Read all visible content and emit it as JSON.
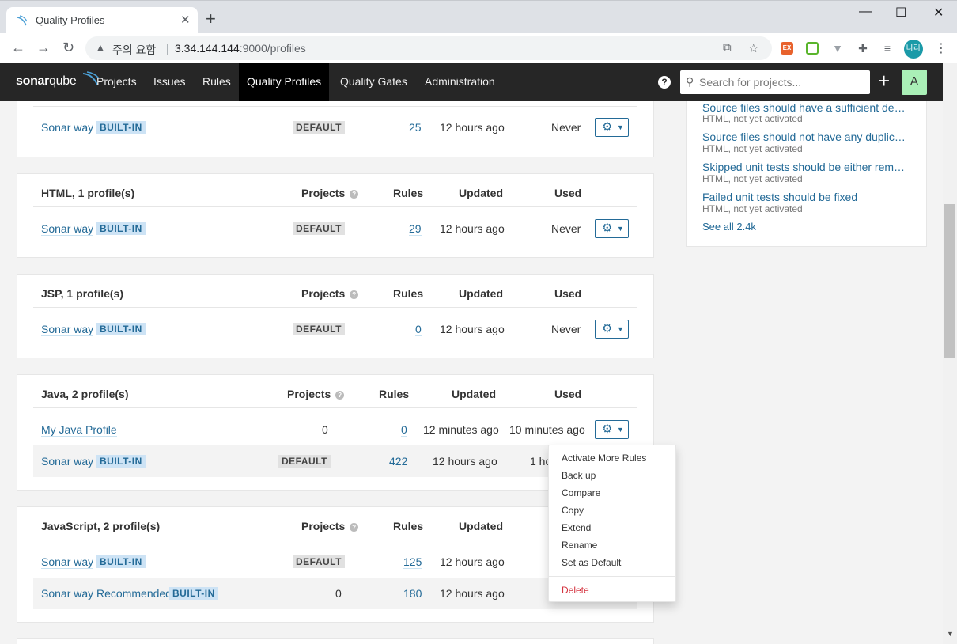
{
  "browser": {
    "tab_title": "Quality Profiles",
    "security_warning": "주의 요함",
    "url_host": "3.34.144.144",
    "url_path": ":9000/profiles",
    "profile_initials": "나라"
  },
  "nav": {
    "logo_bold": "sonar",
    "logo_light": "qube",
    "items": [
      "Projects",
      "Issues",
      "Rules",
      "Quality Profiles",
      "Quality Gates",
      "Administration"
    ],
    "active": "Quality Profiles",
    "search_placeholder": "Search for projects...",
    "avatar": "A"
  },
  "columns": {
    "projects": "Projects",
    "rules": "Rules",
    "updated": "Updated",
    "used": "Used"
  },
  "labels": {
    "built_in": "BUILT-IN",
    "default": "DEFAULT"
  },
  "languages": [
    {
      "header": "",
      "profiles": [
        {
          "name": "Sonar way",
          "built_in": true,
          "projects": "DEFAULT",
          "rules": "25",
          "updated": "12 hours ago",
          "used": "Never"
        }
      ]
    },
    {
      "header": "HTML, 1 profile(s)",
      "profiles": [
        {
          "name": "Sonar way",
          "built_in": true,
          "projects": "DEFAULT",
          "rules": "29",
          "updated": "12 hours ago",
          "used": "Never"
        }
      ]
    },
    {
      "header": "JSP, 1 profile(s)",
      "profiles": [
        {
          "name": "Sonar way",
          "built_in": true,
          "projects": "DEFAULT",
          "rules": "0",
          "updated": "12 hours ago",
          "used": "Never"
        }
      ]
    },
    {
      "header": "Java, 2 profile(s)",
      "profiles": [
        {
          "name": "My Java Profile",
          "built_in": false,
          "projects": "0",
          "rules": "0",
          "updated": "12 minutes ago",
          "used": "10 minutes ago"
        },
        {
          "name": "Sonar way",
          "built_in": true,
          "projects": "DEFAULT",
          "rules": "422",
          "updated": "12 hours ago",
          "used": "1 ho"
        }
      ]
    },
    {
      "header": "JavaScript, 2 profile(s)",
      "profiles": [
        {
          "name": "Sonar way",
          "built_in": true,
          "projects": "DEFAULT",
          "rules": "125",
          "updated": "12 hours ago",
          "used": ""
        },
        {
          "name": "Sonar way Recommended",
          "built_in": true,
          "projects": "0",
          "rules": "180",
          "updated": "12 hours ago",
          "used": ""
        }
      ]
    }
  ],
  "side_panel": {
    "rules": [
      {
        "title": "Source files should have a sufficient density of comment lines",
        "meta": "HTML, not yet activated"
      },
      {
        "title": "Source files should not have any duplicated blocks",
        "meta": "HTML, not yet activated"
      },
      {
        "title": "Skipped unit tests should be either removed or fixed",
        "meta": "HTML, not yet activated"
      },
      {
        "title": "Failed unit tests should be fixed",
        "meta": "HTML, not yet activated"
      }
    ],
    "see_all": "See all 2.4k"
  },
  "dropdown": {
    "items": [
      "Activate More Rules",
      "Back up",
      "Compare",
      "Copy",
      "Extend",
      "Rename",
      "Set as Default"
    ],
    "danger_item": "Delete"
  }
}
